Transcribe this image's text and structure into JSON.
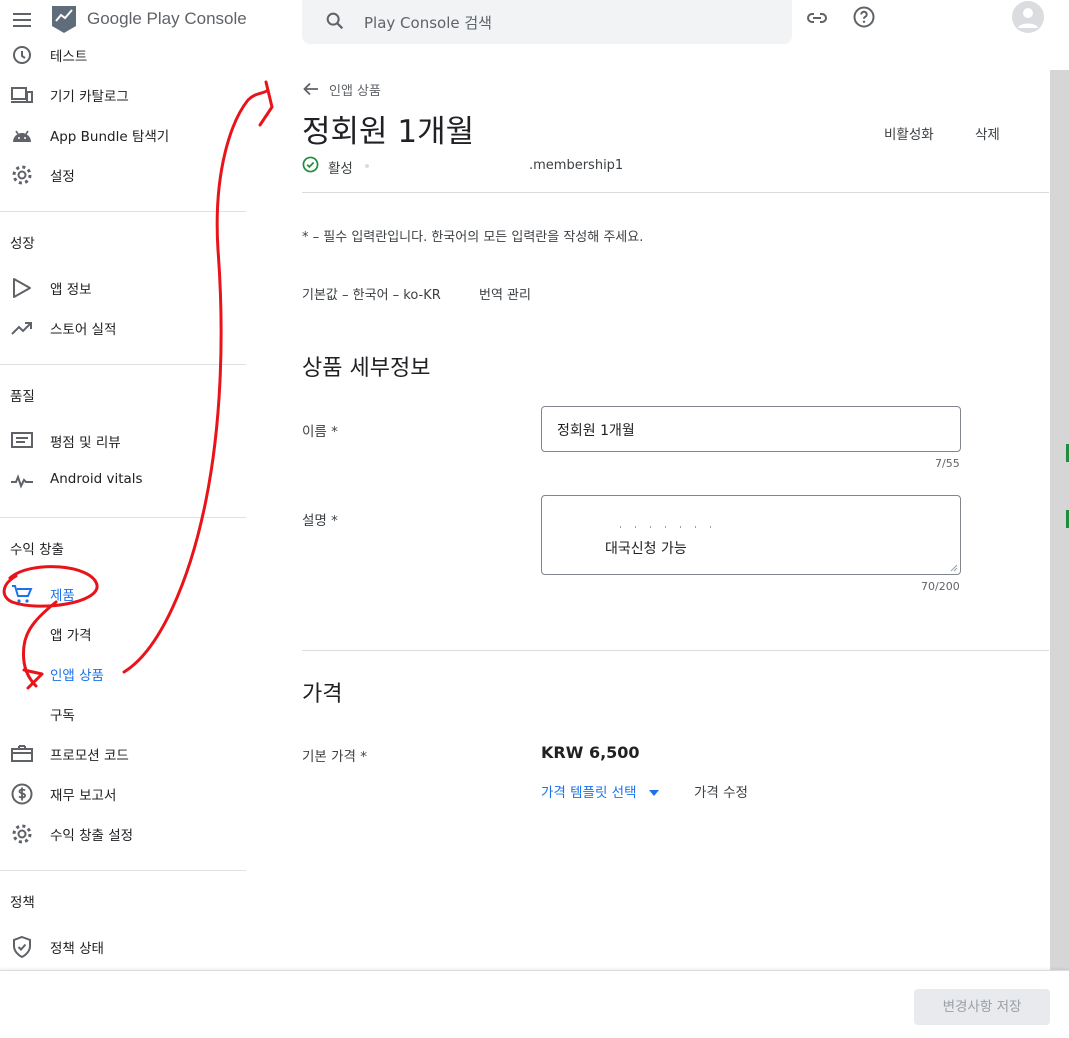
{
  "app": {
    "logo_text": "Google Play Console",
    "menu_icon": "menu-icon"
  },
  "search": {
    "placeholder": "Play Console 검색"
  },
  "sidebar": {
    "items_top": [
      {
        "label": "테스트",
        "icon": "test-icon"
      },
      {
        "label": "기기 카탈로그",
        "icon": "devices-icon"
      },
      {
        "label": "App Bundle 탐색기",
        "icon": "android-icon"
      },
      {
        "label": "설정",
        "icon": "gear-icon"
      }
    ],
    "sections": {
      "growth": "성장",
      "quality": "품질",
      "monetize": "수익 창출",
      "policy": "정책"
    },
    "growth_items": [
      {
        "label": "앱 정보",
        "icon": "play-icon"
      },
      {
        "label": "스토어 실적",
        "icon": "trending-icon"
      }
    ],
    "quality_items": [
      {
        "label": "평점 및 리뷰",
        "icon": "reviews-icon"
      },
      {
        "label": "Android vitals",
        "icon": "vitals-icon"
      }
    ],
    "monetize_items": [
      {
        "label": "제품",
        "icon": "cart-icon"
      },
      {
        "label": "앱 가격"
      },
      {
        "label": "인앱 상품"
      },
      {
        "label": "구독"
      },
      {
        "label": "프로모션 코드",
        "icon": "promo-icon"
      },
      {
        "label": "재무 보고서",
        "icon": "dollar-icon"
      },
      {
        "label": "수익 창출 설정",
        "icon": "gear-icon"
      }
    ],
    "policy_items": [
      {
        "label": "정책 상태",
        "icon": "shield-icon"
      }
    ]
  },
  "page": {
    "back_label": "인앱 상품",
    "title": "정회원 1개월",
    "deactivate": "비활성화",
    "delete": "삭제",
    "status": "활성",
    "product_id": ".membership1",
    "required_note": "* – 필수 입력란입니다. 한국어의 모든 입력란을 작성해 주세요.",
    "default_lang": "기본값 – 한국어 – ko-KR",
    "manage_translations": "번역 관리",
    "details_heading": "상품 세부정보",
    "name_label": "이름 *",
    "name_value": "정회원 1개월",
    "name_count": "7/55",
    "desc_label": "설명 *",
    "desc_value": "대국신청 가능",
    "desc_count": "70/200",
    "price_heading": "가격",
    "base_price_label": "기본 가격 *",
    "base_price_value": "KRW 6,500",
    "price_template": "가격 템플릿 선택",
    "edit_price": "가격 수정"
  },
  "footer": {
    "save": "변경사항 저장"
  },
  "colors": {
    "accent": "#1a73e8",
    "active_green": "#1e8e3e",
    "annotation_red": "#e8141a"
  }
}
